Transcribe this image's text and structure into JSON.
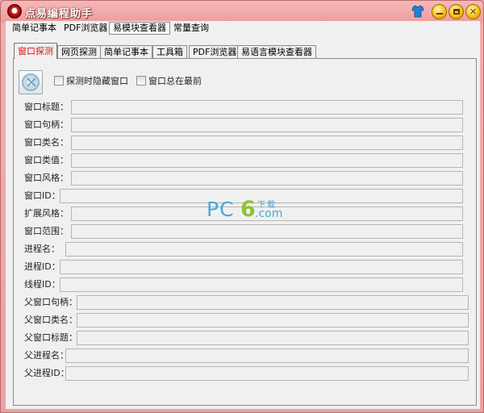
{
  "window": {
    "title": "点易编程助手"
  },
  "menu": [
    {
      "label": "简单记事本"
    },
    {
      "label": "PDF浏览器"
    },
    {
      "label": "易模块查看器"
    },
    {
      "label": "常量查询"
    }
  ],
  "tabs": [
    {
      "label": "窗口探测"
    },
    {
      "label": "网页探测"
    },
    {
      "label": "简单记事本"
    },
    {
      "label": "工具箱"
    },
    {
      "label": "PDF浏览器"
    },
    {
      "label": "易语言模块查看器"
    }
  ],
  "options": {
    "hide_on_probe": {
      "label": "探测时隐藏窗口",
      "checked": false
    },
    "always_on_top": {
      "label": "窗口总在最前",
      "checked": false
    }
  },
  "fields": [
    {
      "label": "窗口标题：",
      "value": ""
    },
    {
      "label": "窗口句柄：",
      "value": ""
    },
    {
      "label": "窗口类名：",
      "value": ""
    },
    {
      "label": "窗口类值：",
      "value": ""
    },
    {
      "label": "窗口风格：",
      "value": ""
    },
    {
      "label": "窗口ID：",
      "value": ""
    },
    {
      "label": "扩展风格：",
      "value": ""
    },
    {
      "label": "窗口范围：",
      "value": ""
    },
    {
      "label": "进程名：",
      "value": ""
    },
    {
      "label": "进程ID：",
      "value": ""
    },
    {
      "label": "线程ID：",
      "value": ""
    },
    {
      "label": "父窗口句柄：",
      "value": ""
    },
    {
      "label": "父窗口类名：",
      "value": ""
    },
    {
      "label": "父窗口标题：",
      "value": ""
    },
    {
      "label": "父进程名：",
      "value": ""
    },
    {
      "label": "父进程ID：",
      "value": ""
    }
  ],
  "watermark": {
    "pc": "PC",
    "six": "6",
    "small": "下载",
    "com": ".com"
  },
  "colors": {
    "title_bar": "#ee9d9d",
    "active_tab_text": "#dd1111",
    "panel": "#f0f0f0"
  }
}
